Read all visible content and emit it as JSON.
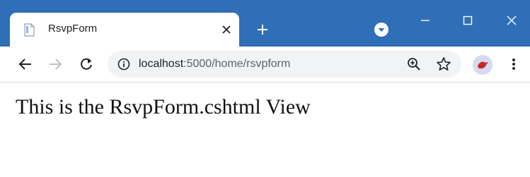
{
  "tab": {
    "title": "RsvpForm"
  },
  "toolbar": {
    "url_host": "localhost",
    "url_rest": ":5000/home/rsvpform"
  },
  "content": {
    "heading": "This is the RsvpForm.cshtml View"
  },
  "colors": {
    "titlebar": "#2f6fb8",
    "avatar_bg": "#d6d9f0",
    "avatar_fg": "#c62828"
  },
  "icons": {
    "favicon": "page-icon",
    "tab_close": "close-icon",
    "new_tab": "plus-icon",
    "tab_search": "chevron-down-icon",
    "back": "arrow-left-icon",
    "forward": "arrow-right-icon",
    "reload": "reload-icon",
    "site_info": "info-icon",
    "zoom": "zoom-icon",
    "bookmark": "star-icon",
    "profile": "avatar",
    "menu": "kebab-menu-icon"
  }
}
